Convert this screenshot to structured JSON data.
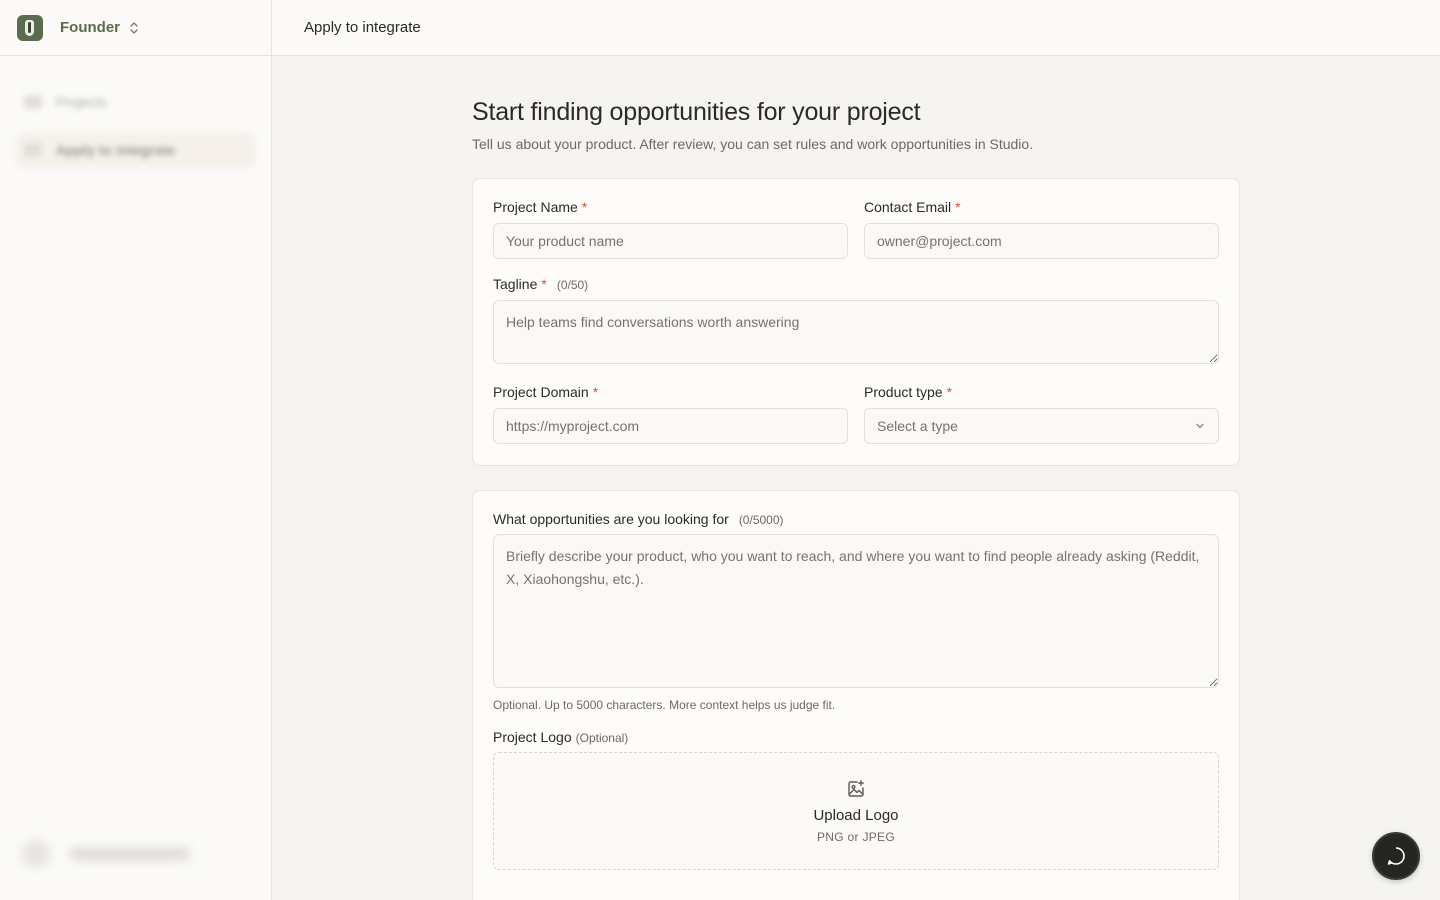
{
  "sidebar": {
    "workspace_name": "Founder",
    "nav_items": [
      {
        "label": "Projects"
      },
      {
        "label": "Apply to integrate"
      }
    ]
  },
  "topbar": {
    "title": "Apply to integrate"
  },
  "page": {
    "title": "Start finding opportunities for your project",
    "subtitle": "Tell us about your product. After review, you can set rules and work opportunities in Studio."
  },
  "form": {
    "required_mark": "*",
    "project_name": {
      "label": "Project Name",
      "placeholder": "Your product name"
    },
    "contact_email": {
      "label": "Contact Email",
      "placeholder": "owner@project.com"
    },
    "tagline": {
      "label": "Tagline",
      "count": "(0/50)",
      "placeholder": "Help teams find conversations worth answering"
    },
    "project_domain": {
      "label": "Project Domain",
      "placeholder": "https://myproject.com"
    },
    "product_type": {
      "label": "Product type",
      "selected": "Select a type"
    },
    "opportunities": {
      "label": "What opportunities are you looking for",
      "count": "(0/5000)",
      "placeholder": "Briefly describe your product, who you want to reach, and where you want to find people already asking (Reddit, X, Xiaohongshu, etc.).",
      "helper": "Optional. Up to 5000 characters. More context helps us judge fit."
    },
    "logo": {
      "label": "Project Logo",
      "optional": "(Optional)",
      "upload_title": "Upload Logo",
      "upload_sub": "PNG or JPEG"
    }
  },
  "colors": {
    "accent": "#5b6b4e",
    "required": "#c7553f",
    "background": "#f5f4f1"
  },
  "icons": {
    "workspace": "founder-logo-icon",
    "switcher": "chevron-up-down-icon",
    "select": "chevron-down-icon",
    "upload": "image-plus-icon",
    "chat": "chat-bubble-icon"
  }
}
